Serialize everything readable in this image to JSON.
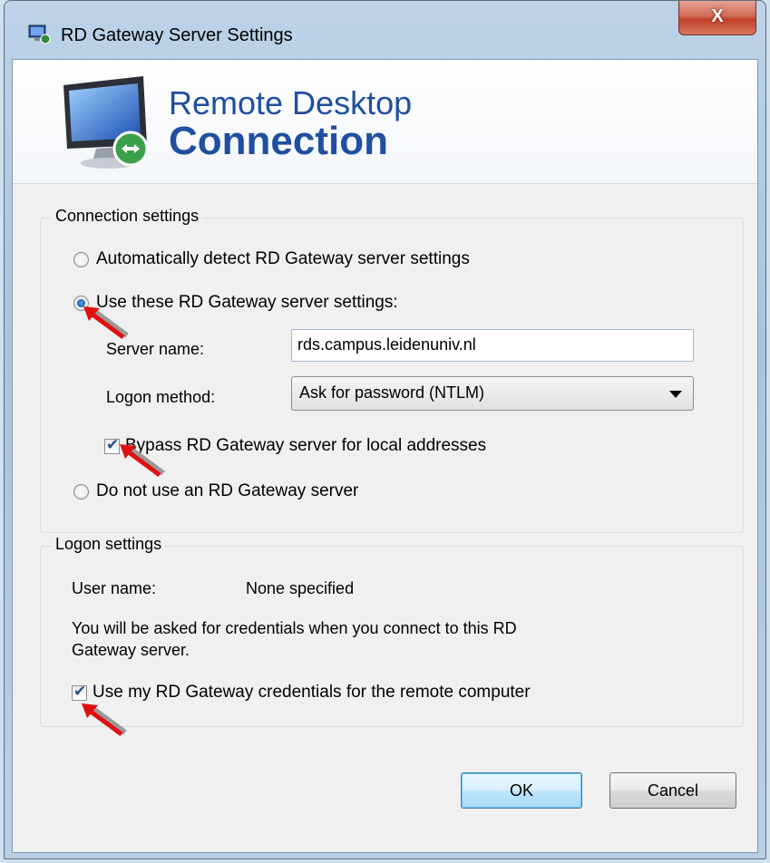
{
  "window": {
    "title": "RD Gateway Server Settings",
    "close_label": "X"
  },
  "banner": {
    "line1": "Remote Desktop",
    "line2": "Connection"
  },
  "connection_settings": {
    "title": "Connection settings",
    "option_auto": "Automatically detect RD Gateway server settings",
    "option_use": "Use these RD Gateway server settings:",
    "server_name_label": "Server name:",
    "server_name_value": "rds.campus.leidenuniv.nl",
    "logon_method_label": "Logon method:",
    "logon_method_value": "Ask for password (NTLM)",
    "bypass_label": "Bypass RD Gateway server for local addresses",
    "option_none": "Do not use an RD Gateway server",
    "selected_option": "use",
    "bypass_checked": true
  },
  "logon_settings": {
    "title": "Logon settings",
    "user_name_label": "User name:",
    "user_name_value": "None specified",
    "info_line1": "You will be asked for credentials when you connect to this RD",
    "info_line2": "Gateway server.",
    "use_creds_label": "Use my RD Gateway credentials for the remote computer",
    "use_creds_checked": true
  },
  "buttons": {
    "ok": "OK",
    "cancel": "Cancel"
  },
  "colors": {
    "accent_title": "#1f4fa0",
    "arrow": "#e01010"
  }
}
